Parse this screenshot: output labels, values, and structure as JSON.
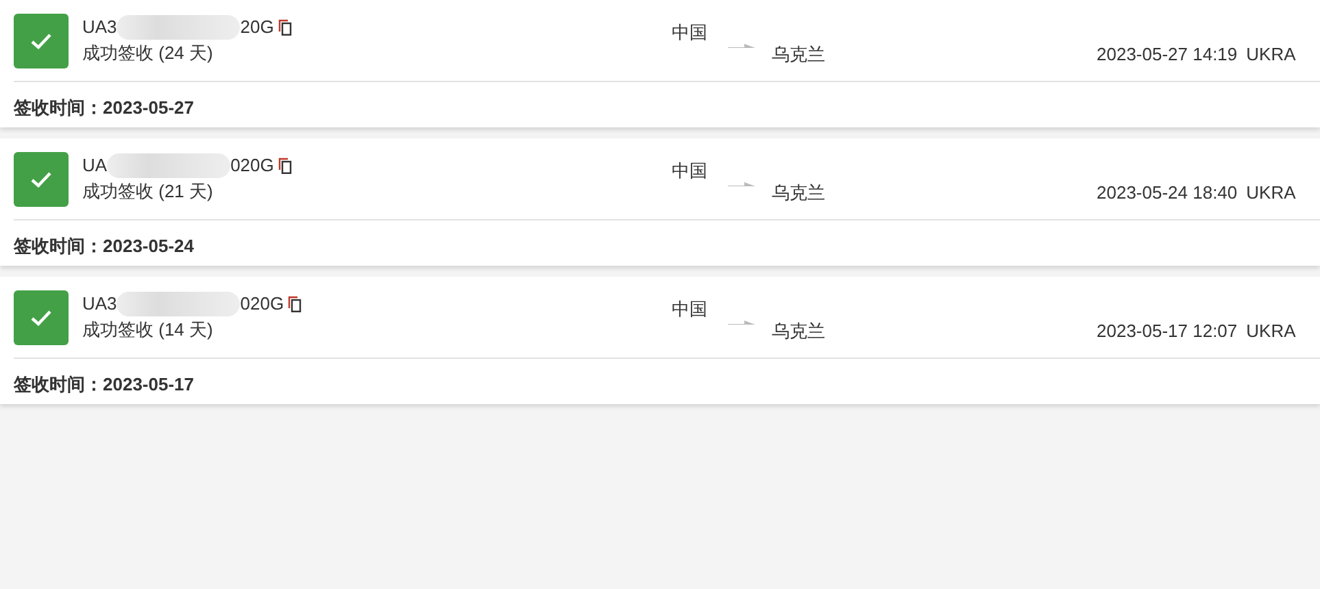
{
  "shipments": [
    {
      "tracking_prefix": "UA3",
      "tracking_suffix": "20G",
      "status": "成功签收 (24 天)",
      "delivered": true,
      "origin": "中国",
      "destination": "乌克兰",
      "datetime": "2023-05-27 14:19",
      "location": "UKRA",
      "signed": "签收时间：2023-05-27"
    },
    {
      "tracking_prefix": "UA",
      "tracking_suffix": "020G",
      "status": "成功签收 (21 天)",
      "delivered": true,
      "origin": "中国",
      "destination": "乌克兰",
      "datetime": "2023-05-24 18:40",
      "location": "UKRA",
      "signed": "签收时间：2023-05-24"
    },
    {
      "tracking_prefix": "UA3",
      "tracking_suffix": "020G",
      "status": "成功签收 (14 天)",
      "delivered": true,
      "origin": "中国",
      "destination": "乌克兰",
      "datetime": "2023-05-17 12:07",
      "location": "UKRA",
      "signed": "签收时间：2023-05-17"
    }
  ]
}
